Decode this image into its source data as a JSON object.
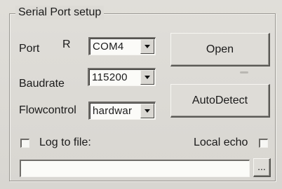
{
  "dialog": {
    "title": "Serial Port setup"
  },
  "port": {
    "label": "Port",
    "indicator": "R",
    "value": "COM4"
  },
  "baudrate": {
    "label": "Baudrate",
    "value": "115200"
  },
  "flowcontrol": {
    "label": "Flowcontrol",
    "value": "hardwar"
  },
  "buttons": {
    "open": "Open",
    "autodetect": "AutoDetect",
    "browse": "..."
  },
  "log_to_file": {
    "label": "Log to file:",
    "checked": false,
    "path": ""
  },
  "local_echo": {
    "label": "Local echo",
    "checked": false
  }
}
